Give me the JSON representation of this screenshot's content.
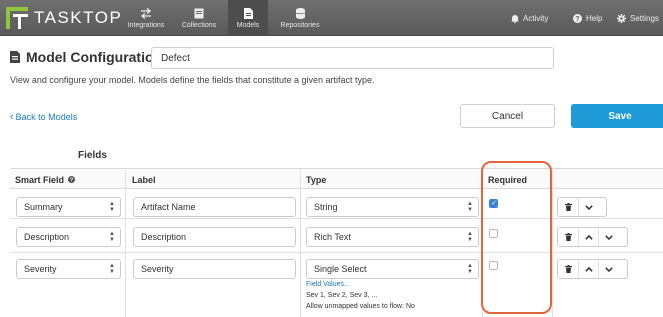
{
  "app": {
    "logo_text": "TASKTOP",
    "colors": {
      "accent": "#1e9ad6",
      "highlight": "#e0663d",
      "link": "#1a7bbf"
    }
  },
  "nav": {
    "items": [
      {
        "label": "Integrations",
        "icon": "arrows-exchange-icon"
      },
      {
        "label": "Collections",
        "icon": "collection-box-icon"
      },
      {
        "label": "Models",
        "icon": "document-icon",
        "active": true
      },
      {
        "label": "Repositories",
        "icon": "database-icon"
      }
    ],
    "right": [
      {
        "label": "Activity",
        "icon": "bell-icon"
      },
      {
        "label": "Help",
        "icon": "help-circle-icon"
      },
      {
        "label": "Settings",
        "icon": "gear-icon"
      }
    ]
  },
  "header": {
    "title": "Model Configuration",
    "model_name": "Defect",
    "description": "View and configure your model. Models define the fields that constitute a given artifact type."
  },
  "actions": {
    "back": "Back to Models",
    "cancel": "Cancel",
    "save": "Save"
  },
  "fields": {
    "title": "Fields",
    "columns": {
      "smart_field": "Smart Field",
      "label": "Label",
      "type": "Type",
      "required": "Required"
    },
    "rows": [
      {
        "smart_field": "Summary",
        "label": "Artifact Name",
        "type": "String",
        "required": true
      },
      {
        "smart_field": "Description",
        "label": "Description",
        "type": "Rich Text",
        "required": false
      },
      {
        "smart_field": "Severity",
        "label": "Severity",
        "type": "Single Select",
        "required": false,
        "field_values_link": "Field Values...",
        "values_summary": "Sev 1, Sev 2, Sev 3, ...",
        "unmapped_note": "Allow unmapped values to flow: No"
      }
    ]
  }
}
